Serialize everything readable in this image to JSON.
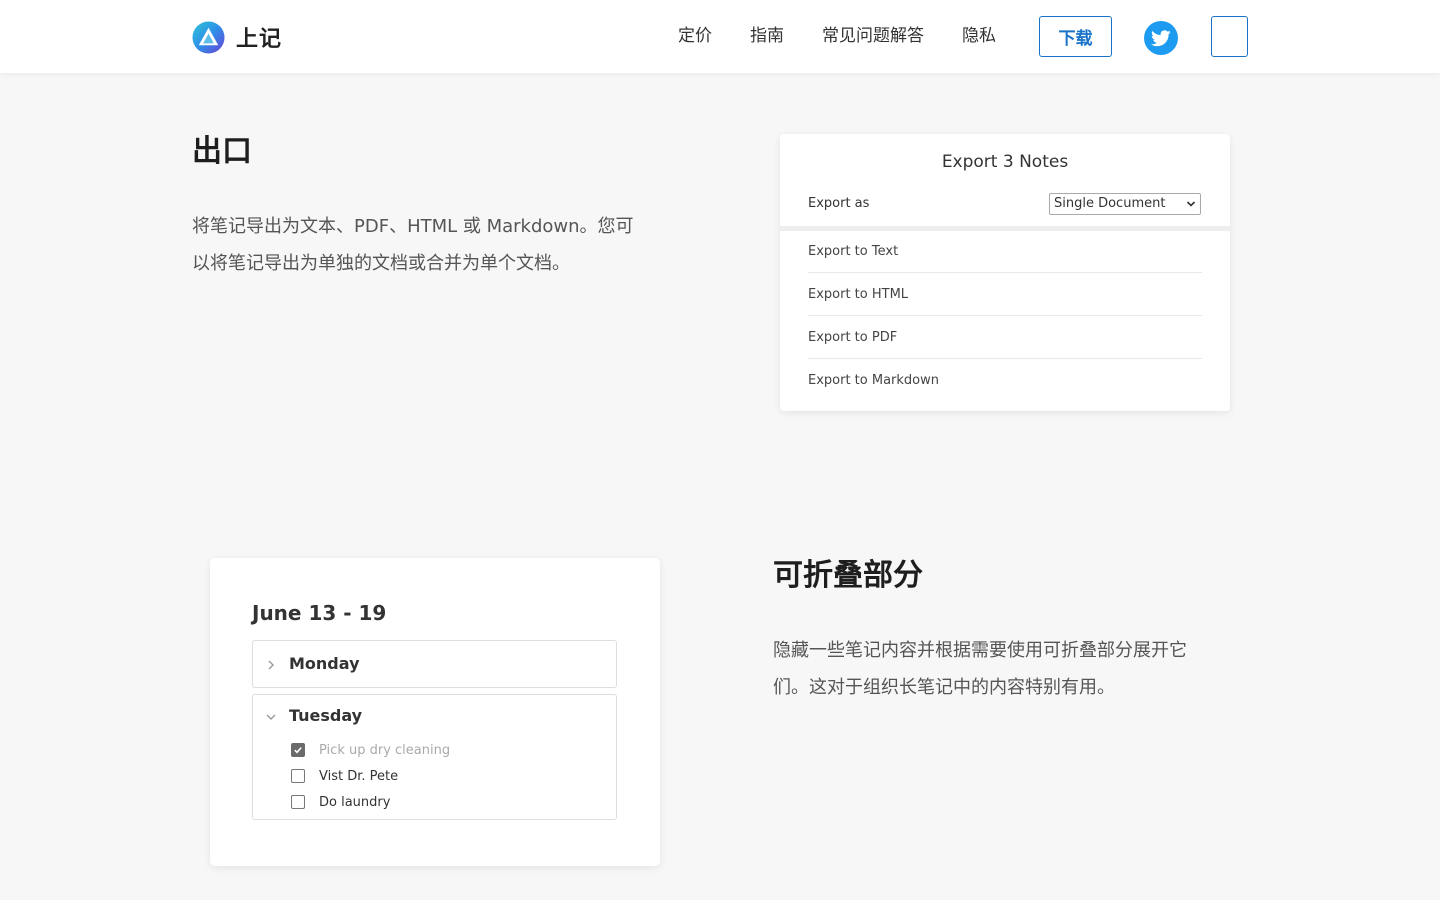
{
  "header": {
    "brand_name": "上记",
    "nav": [
      "定价",
      "指南",
      "常见问题解答",
      "隐私"
    ],
    "download_label": "下载",
    "twitter_color": "#1d9bf0",
    "accent_color": "#1a73c8"
  },
  "export_section": {
    "title": "出口",
    "desc_line1": "将笔记导出为文本、PDF、HTML 或 Markdown。您可",
    "desc_line2": "以将笔记导出为单独的文档或合并为单个文档。",
    "card": {
      "title": "Export 3 Notes",
      "export_as_label": "Export as",
      "select_value": "Single Document",
      "items": [
        "Export to Text",
        "Export to HTML",
        "Export to PDF",
        "Export to Markdown"
      ]
    }
  },
  "fold_section": {
    "title": "可折叠部分",
    "desc_line1": "隐藏一些笔记内容并根据需要使用可折叠部分展开它",
    "desc_line2": "们。这对于组织长笔记中的内容特别有用。",
    "card": {
      "heading": "June 13 - 19",
      "monday": "Monday",
      "tuesday": "Tuesday",
      "todos": [
        {
          "text": "Pick up dry cleaning",
          "checked": true
        },
        {
          "text": "Vist Dr. Pete",
          "checked": false
        },
        {
          "text": "Do laundry",
          "checked": false
        }
      ]
    }
  }
}
